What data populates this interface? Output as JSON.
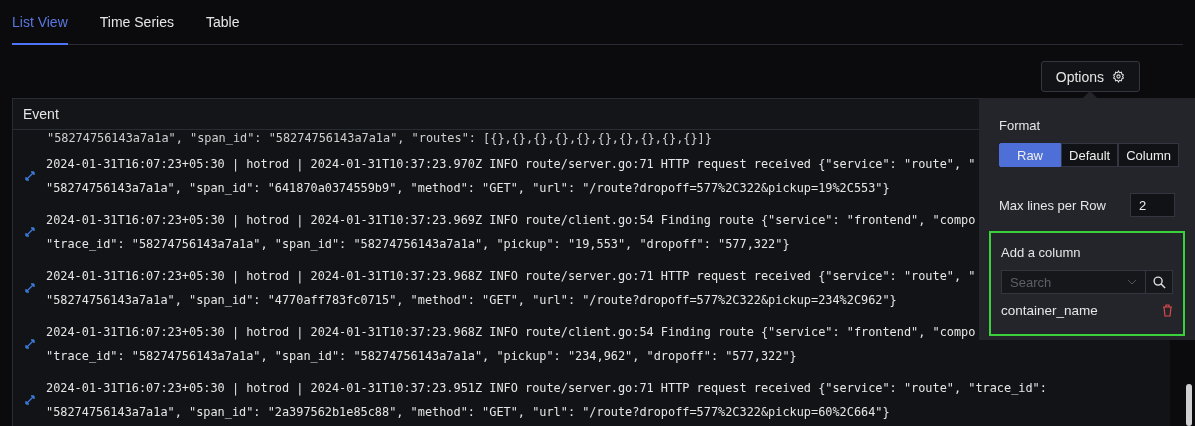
{
  "tabs": [
    {
      "label": "List View",
      "selected": true
    },
    {
      "label": "Time Series",
      "selected": false
    },
    {
      "label": "Table",
      "selected": false
    }
  ],
  "options_button": {
    "label": "Options"
  },
  "table": {
    "header": "Event",
    "partial_line": "\"58274756143a7a1a\", \"span_id\": \"58274756143a7a1a\", \"routes\": [{},{},{},{},{},{},{},{},{},{}]}",
    "rows": [
      {
        "lines": [
          "2024-01-31T16:07:23+05:30 | hotrod | 2024-01-31T10:37:23.970Z INFO route/server.go:71 HTTP request received {\"service\": \"route\", \"",
          "\"58274756143a7a1a\", \"span_id\": \"641870a0374559b9\", \"method\": \"GET\", \"url\": \"/route?dropoff=577%2C322&pickup=19%2C553\"}"
        ]
      },
      {
        "lines": [
          "2024-01-31T16:07:23+05:30 | hotrod | 2024-01-31T10:37:23.969Z INFO route/client.go:54 Finding route {\"service\": \"frontend\", \"compo",
          "\"trace_id\": \"58274756143a7a1a\", \"span_id\": \"58274756143a7a1a\", \"pickup\": \"19,553\", \"dropoff\": \"577,322\"}"
        ]
      },
      {
        "lines": [
          "2024-01-31T16:07:23+05:30 | hotrod | 2024-01-31T10:37:23.968Z INFO route/server.go:71 HTTP request received {\"service\": \"route\", \"",
          "\"58274756143a7a1a\", \"span_id\": \"4770aff783fc0715\", \"method\": \"GET\", \"url\": \"/route?dropoff=577%2C322&pickup=234%2C962\"}"
        ]
      },
      {
        "lines": [
          "2024-01-31T16:07:23+05:30 | hotrod | 2024-01-31T10:37:23.968Z INFO route/client.go:54 Finding route {\"service\": \"frontend\", \"compo",
          "\"trace_id\": \"58274756143a7a1a\", \"span_id\": \"58274756143a7a1a\", \"pickup\": \"234,962\", \"dropoff\": \"577,322\"}"
        ]
      },
      {
        "lines": [
          "2024-01-31T16:07:23+05:30 | hotrod | 2024-01-31T10:37:23.951Z INFO route/server.go:71 HTTP request received {\"service\": \"route\", \"trace_id\":",
          "\"58274756143a7a1a\", \"span_id\": \"2a397562b1e85c88\", \"method\": \"GET\", \"url\": \"/route?dropoff=577%2C322&pickup=60%2C664\"}"
        ]
      }
    ]
  },
  "options_popover": {
    "format_label": "Format",
    "formats": [
      {
        "label": "Raw",
        "selected": true
      },
      {
        "label": "Default",
        "selected": false
      },
      {
        "label": "Column",
        "selected": false
      }
    ],
    "max_lines_label": "Max lines per Row",
    "max_lines_value": "2",
    "add_column": {
      "highlighted": true,
      "label": "Add a column",
      "search_placeholder": "Search",
      "columns": [
        "container_name"
      ]
    }
  }
}
